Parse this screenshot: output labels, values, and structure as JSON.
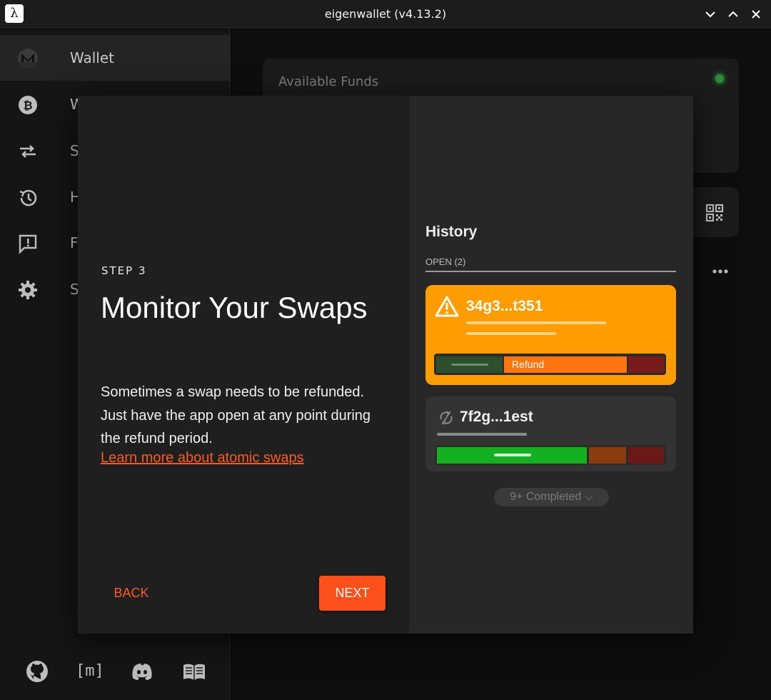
{
  "window": {
    "title": "eigenwallet (v4.13.2)",
    "app_icon": "λ"
  },
  "sidebar": {
    "items": [
      {
        "label": "Wallet",
        "icon": "monero-icon",
        "active": true
      },
      {
        "label": "W",
        "icon": "bitcoin-icon"
      },
      {
        "label": "S",
        "icon": "swap-arrows-icon"
      },
      {
        "label": "H",
        "icon": "history-icon"
      },
      {
        "label": "F",
        "icon": "feedback-icon"
      },
      {
        "label": "S",
        "icon": "settings-icon"
      }
    ],
    "footer": [
      {
        "icon": "github-icon"
      },
      {
        "icon": "matrix-icon",
        "text": "[m]"
      },
      {
        "icon": "discord-icon"
      },
      {
        "icon": "book-icon"
      }
    ]
  },
  "background": {
    "funds_label": "Available Funds"
  },
  "modal": {
    "step": "STEP 3",
    "title": "Monitor Your Swaps",
    "description": "Sometimes a swap needs to be refunded. Just have the app open at any point during the refund period.",
    "link": "Learn more about atomic swaps",
    "back_label": "BACK",
    "next_label": "NEXT"
  },
  "history_preview": {
    "title": "History",
    "open_label": "OPEN (2)",
    "swaps": [
      {
        "id": "34g3...t351",
        "status_label": "Refund",
        "color": "#ff9d00"
      },
      {
        "id": "7f2g...1est",
        "color": "#333333"
      }
    ],
    "completed_chip": "9+ Completed"
  },
  "colors": {
    "accent": "#ff4f1a",
    "warning": "#ff9d00",
    "success": "#13b01f",
    "danger": "#7a1b1b"
  }
}
